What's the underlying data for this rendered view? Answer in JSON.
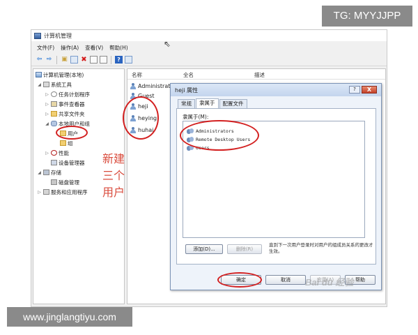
{
  "watermarks": {
    "tg": "TG: MYYJJPP",
    "url": "www.jinglangtiyu.com",
    "baidu": "Bai du 经验"
  },
  "window": {
    "title": "计算机管理"
  },
  "menu": [
    "文件(F)",
    "操作(A)",
    "查看(V)",
    "帮助(H)"
  ],
  "toolbar_icons": [
    "back-arrow-icon",
    "forward-arrow-icon",
    "up-folder-icon",
    "show-tree-icon",
    "delete-icon",
    "properties-icon",
    "refresh-icon",
    "help-icon",
    "view-icon"
  ],
  "tree": [
    {
      "label": "计算机管理(本地)",
      "icon": "computer-icon"
    },
    {
      "label": "系统工具",
      "icon": "tools-icon"
    },
    {
      "label": "任务计划程序",
      "icon": "clock-icon"
    },
    {
      "label": "事件查看器",
      "icon": "event-viewer-icon"
    },
    {
      "label": "共享文件夹",
      "icon": "shared-folder-icon"
    },
    {
      "label": "本地用户和组",
      "icon": "users-icon"
    },
    {
      "label": "用户",
      "icon": "folder-icon"
    },
    {
      "label": "组",
      "icon": "folder-icon"
    },
    {
      "label": "性能",
      "icon": "performance-icon"
    },
    {
      "label": "设备管理器",
      "icon": "device-manager-icon"
    },
    {
      "label": "存储",
      "icon": "storage-icon"
    },
    {
      "label": "磁盘管理",
      "icon": "disk-icon"
    },
    {
      "label": "服务和应用程序",
      "icon": "services-icon"
    }
  ],
  "list": {
    "columns": [
      "名称",
      "全名",
      "描述"
    ],
    "users": [
      "Administrat",
      "Guest",
      "heji",
      "heying",
      "huhai"
    ]
  },
  "annotation": [
    "新建",
    "三个",
    "用户"
  ],
  "dialog": {
    "title": "heji 属性",
    "help_label": "?",
    "close_label": "X",
    "tabs": [
      "常规",
      "隶属于",
      "配置文件"
    ],
    "member_of_label": "隶属于(M):",
    "groups": [
      "Administrators",
      "Remote Desktop Users",
      "Users"
    ],
    "add_label": "添加(D)...",
    "remove_label": "删除(R)",
    "hint": "直到下一次用户登录时对用户的组成员关系的更改才生效。",
    "ok_label": "确定",
    "cancel_label": "取消",
    "apply_label": "应用(A)",
    "help_button_label": "帮助"
  }
}
